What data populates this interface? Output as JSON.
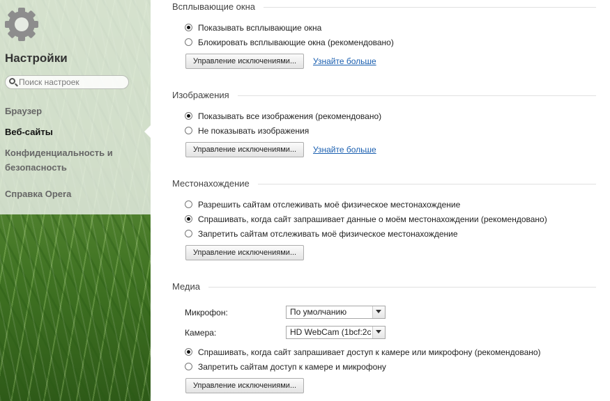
{
  "sidebar": {
    "title": "Настройки",
    "search_placeholder": "Поиск настроек",
    "nav": [
      {
        "label": "Браузер"
      },
      {
        "label": "Веб-сайты"
      },
      {
        "label": "Конфиденциальность и безопасность"
      },
      {
        "label": "Справка Opera"
      }
    ],
    "active_item": "Веб-сайты"
  },
  "popups": {
    "title": "Всплывающие окна",
    "options": [
      {
        "label": "Показывать всплывающие окна",
        "checked": true
      },
      {
        "label": "Блокировать всплывающие окна (рекомендовано)",
        "checked": false
      }
    ],
    "manage_button": "Управление исключениями...",
    "learn_more": "Узнайте больше"
  },
  "images": {
    "title": "Изображения",
    "options": [
      {
        "label": "Показывать все изображения (рекомендовано)",
        "checked": true
      },
      {
        "label": "Не показывать изображения",
        "checked": false
      }
    ],
    "manage_button": "Управление исключениями...",
    "learn_more": "Узнайте больше"
  },
  "location": {
    "title": "Местонахождение",
    "options": [
      {
        "label": "Разрешить сайтам отслеживать моё физическое местонахождение",
        "checked": false
      },
      {
        "label": "Спрашивать, когда сайт запрашивает данные о моём местонахождении (рекомендовано)",
        "checked": true
      },
      {
        "label": "Запретить сайтам отслеживать моё физическое местонахождение",
        "checked": false
      }
    ],
    "manage_button": "Управление исключениями..."
  },
  "media": {
    "title": "Медиа",
    "microphone_label": "Микрофон:",
    "microphone_value": "По умолчанию",
    "camera_label": "Камера:",
    "camera_value": "HD WebCam (1bcf:2c",
    "options": [
      {
        "label": "Спрашивать, когда сайт запрашивает доступ к камере или микрофону (рекомендовано)",
        "checked": true
      },
      {
        "label": "Запретить сайтам доступ к камере и микрофону",
        "checked": false
      }
    ],
    "manage_button": "Управление исключениями..."
  }
}
